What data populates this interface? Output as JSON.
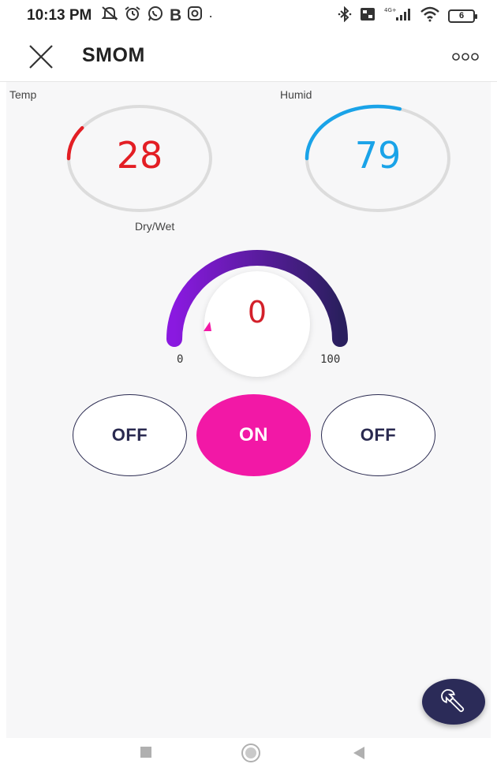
{
  "status_bar": {
    "time": "10:13 PM",
    "left_icons": [
      "silent-icon",
      "alarm-icon",
      "whatsapp-icon",
      "b-icon",
      "instagram-icon",
      "dot-icon"
    ],
    "right_icons": [
      "bluetooth-icon",
      "volte-icon",
      "4g-signal-icon",
      "wifi-icon",
      "battery-icon"
    ],
    "network_label": "4G+",
    "battery_level": "6"
  },
  "app_bar": {
    "title": "SMOM",
    "close_icon": "close-icon",
    "more_icon": "more-options-icon"
  },
  "gauges": {
    "temp": {
      "label": "Temp",
      "value": "28",
      "color": "#e31e24",
      "fraction": 0.1
    },
    "humid": {
      "label": "Humid",
      "value": "79",
      "color": "#1aa3e8",
      "fraction": 0.3
    }
  },
  "dial": {
    "label": "Dry/Wet",
    "value": "0",
    "min": "0",
    "max": "100",
    "gradient_start": "#8a19e0",
    "gradient_end": "#2a1f5e",
    "pointer_color": "#f218a6"
  },
  "buttons": [
    {
      "label": "OFF",
      "state": "off"
    },
    {
      "label": "ON",
      "state": "on"
    },
    {
      "label": "OFF",
      "state": "off"
    }
  ],
  "colors": {
    "accent_on": "#f218a6",
    "outline": "#2a2a50",
    "fab": "#2b2b58"
  },
  "fab_icon": "wrench-icon",
  "nav_bar": {
    "icons": [
      "recent-apps-icon",
      "home-icon",
      "back-icon"
    ]
  }
}
